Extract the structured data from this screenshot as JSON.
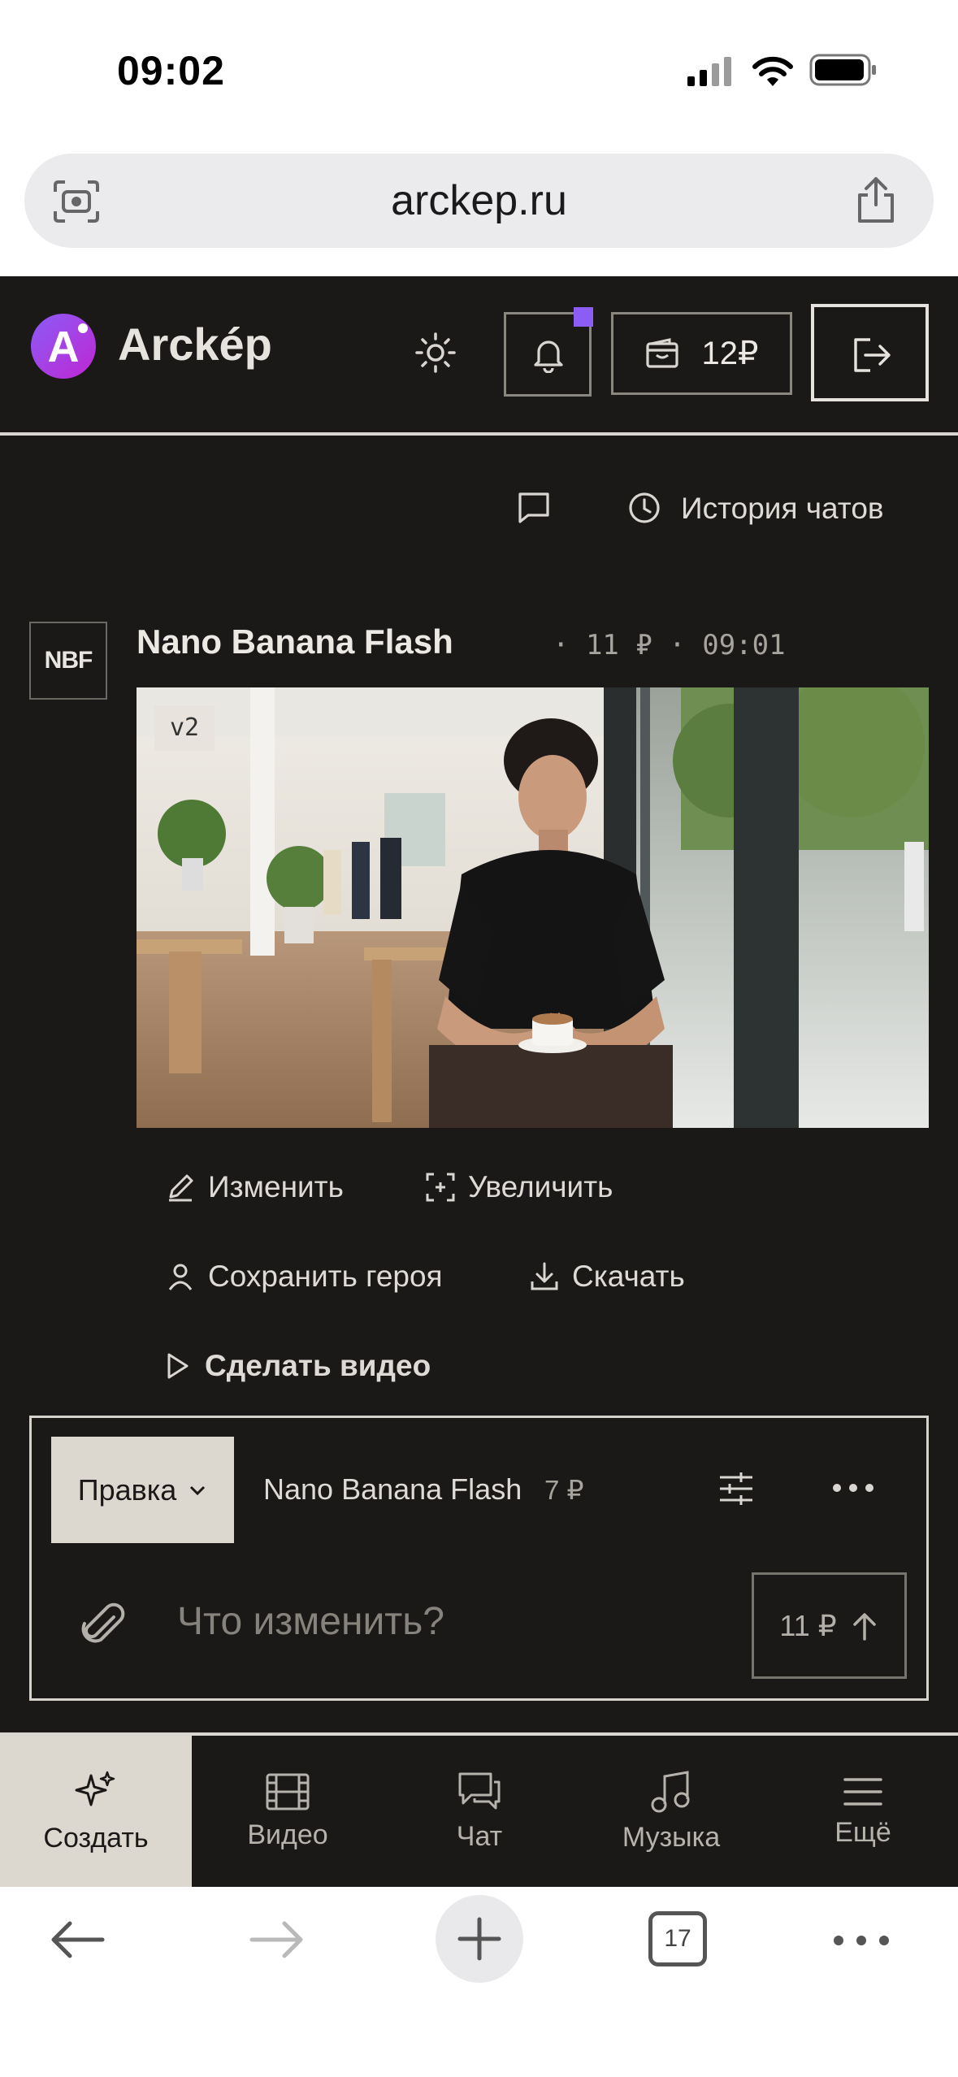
{
  "status_bar": {
    "time": "09:02"
  },
  "browser": {
    "url": "arckep.ru",
    "tab_count": "17"
  },
  "header": {
    "brand": "Arckép",
    "logo_letter": "A",
    "balance": "12₽"
  },
  "chat_actions": {
    "history_label": "История чатов"
  },
  "message": {
    "avatar_text": "NBF",
    "title": "Nano Banana Flash",
    "meta": "· 11 ₽ · 09:01",
    "version_badge": "v2",
    "actions": {
      "edit": "Изменить",
      "upscale": "Увеличить",
      "save_hero": "Сохранить героя",
      "download": "Скачать",
      "make_video": "Сделать видео"
    }
  },
  "composer": {
    "mode": "Правка",
    "model": "Nano Banana Flash",
    "model_price": "7 ₽",
    "placeholder": "Что изменить?",
    "send_price": "11 ₽"
  },
  "nav": [
    {
      "label": "Создать",
      "icon": "sparkles-icon",
      "active": true
    },
    {
      "label": "Видео",
      "icon": "film-icon"
    },
    {
      "label": "Чат",
      "icon": "chat-icon"
    },
    {
      "label": "Музыка",
      "icon": "music-icon"
    },
    {
      "label": "Ещё",
      "icon": "menu-icon"
    }
  ],
  "colors": {
    "background": "#1b1918",
    "accent": "#8b5cf6",
    "active_tab": "#dcd8d0"
  }
}
